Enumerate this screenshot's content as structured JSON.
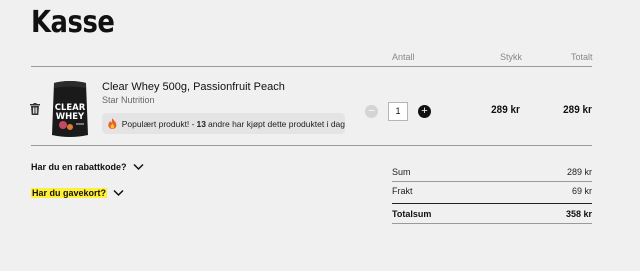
{
  "page": {
    "title": "Kasse"
  },
  "table_header": {
    "quantity": "Antall",
    "unit_price": "Stykk",
    "total": "Totalt"
  },
  "cart_item": {
    "name": "Clear Whey 500g, Passionfruit Peach",
    "brand": "Star Nutrition",
    "image_text": {
      "line1": "CLEAR",
      "line2": "WHEY"
    },
    "popular": {
      "prefix": "Populært produkt! -",
      "count": "13",
      "suffix": "andre har kjøpt dette produktet i dag"
    },
    "quantity": "1",
    "minus_label": "−",
    "plus_label": "+",
    "unit_price": "289 kr",
    "line_total": "289 kr"
  },
  "discount": {
    "label": "Har du en rabattkode?"
  },
  "giftcard": {
    "label": "Har du gavekort?"
  },
  "summary": {
    "subtotal_label": "Sum",
    "subtotal_value": "289 kr",
    "shipping_label": "Frakt",
    "shipping_value": "69 kr",
    "total_label": "Totalsum",
    "total_value": "358 kr"
  },
  "colors": {
    "highlight": "#ffef36",
    "background": "#f0f0f0",
    "text": "#111111"
  }
}
